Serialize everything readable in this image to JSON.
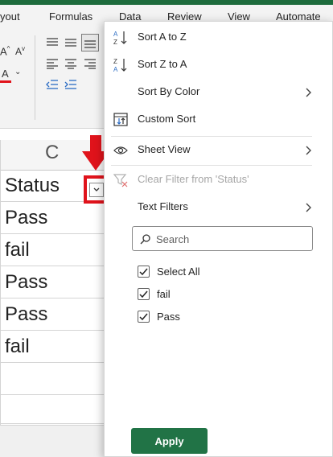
{
  "ribbon": {
    "tabs": [
      {
        "label": "yout"
      },
      {
        "label": "Formulas"
      },
      {
        "label": "Data"
      },
      {
        "label": "Review"
      },
      {
        "label": "View"
      },
      {
        "label": "Automate"
      }
    ],
    "font_buttons": {
      "increase": "A",
      "decrease": "A",
      "font_color": "A"
    },
    "accent_color": "#217346",
    "font_color_bar": "#e0131b"
  },
  "sheet": {
    "column_letter": "C",
    "cells": [
      "Status",
      "Pass",
      "fail",
      "Pass",
      "Pass",
      "fail"
    ]
  },
  "menu": {
    "items": [
      {
        "label": "Sort A to Z",
        "icon": "sort-ascending-icon",
        "submenu": false,
        "disabled": false
      },
      {
        "label": "Sort Z to A",
        "icon": "sort-descending-icon",
        "submenu": false,
        "disabled": false
      },
      {
        "label": "Sort By Color",
        "icon": "",
        "submenu": true,
        "disabled": false
      },
      {
        "label": "Custom Sort",
        "icon": "custom-sort-icon",
        "submenu": false,
        "disabled": false
      },
      {
        "label": "Sheet View",
        "icon": "eye-icon",
        "submenu": true,
        "disabled": false
      },
      {
        "label": "Clear Filter from 'Status'",
        "icon": "clear-filter-icon",
        "submenu": false,
        "disabled": true
      },
      {
        "label": "Text Filters",
        "icon": "",
        "submenu": true,
        "disabled": false
      }
    ],
    "search": {
      "placeholder": "Search",
      "value": ""
    },
    "checklist": [
      {
        "label": "Select All",
        "checked": true
      },
      {
        "label": "fail",
        "checked": true
      },
      {
        "label": "Pass",
        "checked": true
      }
    ],
    "apply_label": "Apply"
  },
  "annotation": {
    "color": "#e0131b"
  }
}
